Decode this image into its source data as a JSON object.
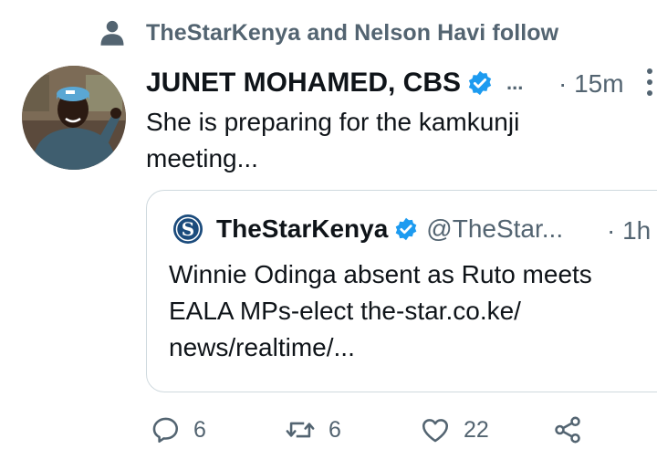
{
  "social_context": {
    "text": "TheStarKenya and Nelson Havi follow",
    "icon": "person-icon"
  },
  "tweet": {
    "author_name": "JUNET MOHAMED, CBS",
    "truncation": "...",
    "time": "· 15m",
    "text": "She is preparing for the kamkunji meeting...",
    "verified": true
  },
  "quoted_tweet": {
    "name": "TheStarKenya",
    "handle": "@TheStar...",
    "time": "· 1h",
    "text": "Winnie Odinga absent as Ruto meets EALA MPs-elect the-star.co.ke/ news/realtime/...",
    "verified": true
  },
  "actions": {
    "replies": "6",
    "retweets": "6",
    "likes": "22",
    "icons": [
      "reply-icon",
      "retweet-icon",
      "like-icon",
      "share-icon"
    ]
  },
  "colors": {
    "verified_blue": "#1d9bf0",
    "secondary_text": "#536471",
    "primary_text": "#0f1419",
    "border": "#cfd9de"
  }
}
